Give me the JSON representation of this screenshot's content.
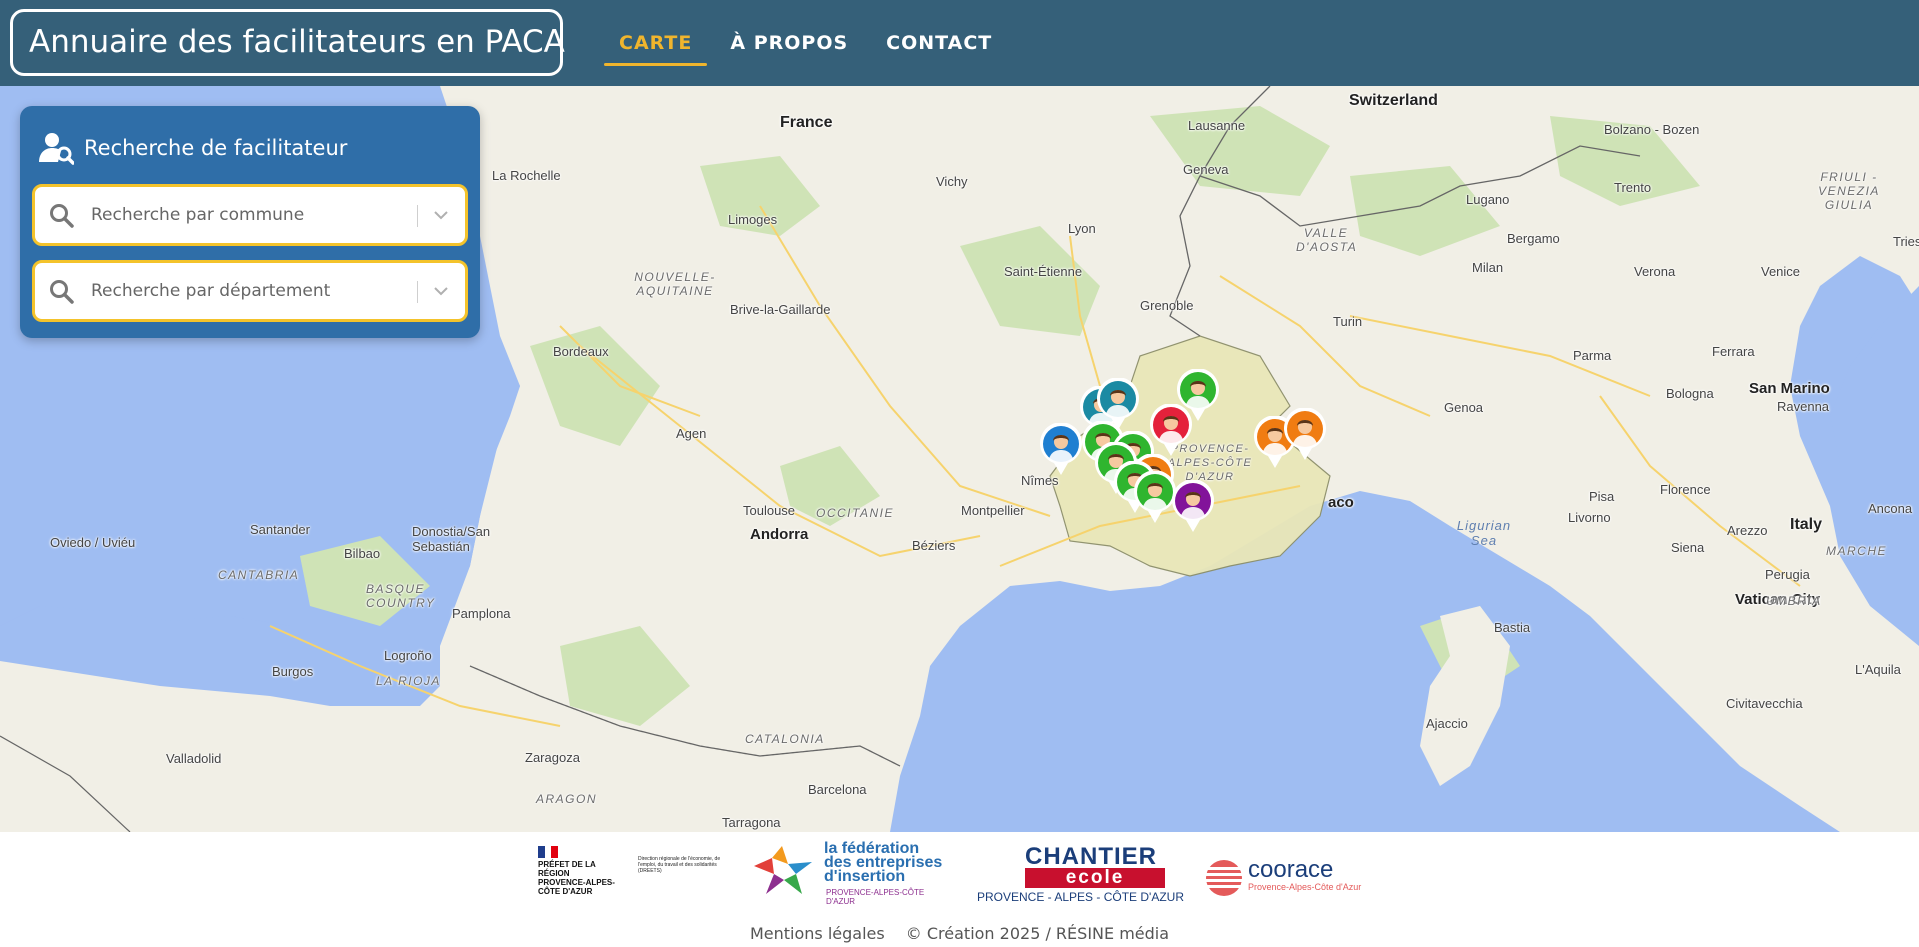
{
  "header": {
    "title": "Annuaire des facilitateurs en PACA",
    "nav": [
      {
        "label": "CARTE",
        "active": true
      },
      {
        "label": "À PROPOS",
        "active": false
      },
      {
        "label": "CONTACT",
        "active": false
      }
    ]
  },
  "search_panel": {
    "title": "Recherche de facilitateur",
    "commune_placeholder": "Recherche par commune",
    "departement_placeholder": "Recherche par département"
  },
  "map": {
    "labels": {
      "france": "France",
      "switzerland": "Switzerland",
      "italy": "Italy",
      "andorra": "Andorra",
      "san_marino": "San Marino",
      "vatican": "Vatican City",
      "la_rochelle": "La Rochelle",
      "vichy": "Vichy",
      "lausanne": "Lausanne",
      "geneva": "Geneva",
      "limoges": "Limoges",
      "lyon": "Lyon",
      "saint_etienne": "Saint-Étienne",
      "nouvelle_aquitaine": "NOUVELLE-AQUITAINE",
      "brive": "Brive-la-Gaillarde",
      "grenoble": "Grenoble",
      "bordeaux": "Bordeaux",
      "agen": "Agen",
      "toulouse": "Toulouse",
      "occitanie": "OCCITANIE",
      "montpellier": "Montpellier",
      "nimes": "Nîmes",
      "beziers": "Béziers",
      "paca": "PROVENCE-ALPES-CÔTE D'AZUR",
      "monaco": "aco",
      "santander": "Santander",
      "oviedo": "Oviedo / Uviéu",
      "bilbao": "Bilbao",
      "donostia": "Donostia/San Sebastián",
      "cantabria": "CANTABRIA",
      "basque": "BASQUE COUNTRY",
      "pamplona": "Pamplona",
      "logrono": "Logroño",
      "burgos": "Burgos",
      "la_rioja": "LA RIOJA",
      "valladolid": "Valladolid",
      "zaragoza": "Zaragoza",
      "aragon": "ARAGON",
      "catalonia": "CATALONIA",
      "barcelona": "Barcelona",
      "tarragona": "Tarragona",
      "lugano": "Lugano",
      "bolzano": "Bolzano - Bozen",
      "trento": "Trento",
      "valle_aosta": "VALLE D'AOSTA",
      "bergamo": "Bergamo",
      "milan": "Milan",
      "verona": "Verona",
      "venice": "Venice",
      "friuli": "FRIULI - VENEZIA GIULIA",
      "turin": "Turin",
      "parma": "Parma",
      "ferrara": "Ferrara",
      "bologna": "Bologna",
      "ravenna": "Ravenna",
      "genoa": "Genoa",
      "pisa": "Pisa",
      "florence": "Florence",
      "livorno": "Livorno",
      "arezzo": "Arezzo",
      "ancona": "Ancona",
      "siena": "Siena",
      "perugia": "Perugia",
      "marche": "MARCHE",
      "umbria": "UMBRIA",
      "ligurian": "Ligurian Sea",
      "bastia": "Bastia",
      "ajaccio": "Ajaccio",
      "laquila": "L'Aquila",
      "civitavecchia": "Civitavecchia",
      "tries": "Tries"
    },
    "markers": [
      {
        "color": "#2fb52f"
      },
      {
        "color": "#1b8aa3"
      },
      {
        "color": "#1b8aa3"
      },
      {
        "color": "#e4213b"
      },
      {
        "color": "#1f7fd1"
      },
      {
        "color": "#2fb52f"
      },
      {
        "color": "#2fb52f"
      },
      {
        "color": "#2fb52f"
      },
      {
        "color": "#f07c12"
      },
      {
        "color": "#2fb52f"
      },
      {
        "color": "#2fb52f"
      },
      {
        "color": "#82139a"
      },
      {
        "color": "#f07c12"
      },
      {
        "color": "#f07c12"
      }
    ]
  },
  "footer": {
    "prefet": "PRÉFET DE LA RÉGION PROVENCE-ALPES-CÔTE D'AZUR",
    "dreets": "Direction régionale de l'économie, de l'emploi, du travail et des solidarités (DREETS)",
    "federation_line1": "la fédération",
    "federation_line2": "des entreprises",
    "federation_line3": "d'insertion",
    "federation_region": "PROVENCE-ALPES-CÔTE D'AZUR",
    "chantier": "CHANTIER",
    "ecole": "ecole",
    "chantier_region": "PROVENCE - ALPES - CÔTE D'AZUR",
    "coorace": "coorace",
    "coorace_region": "Provence-Alpes-Côte d'Azur",
    "mentions": "Mentions légales",
    "credit": "© Création 2025 / RÉSINE média"
  }
}
